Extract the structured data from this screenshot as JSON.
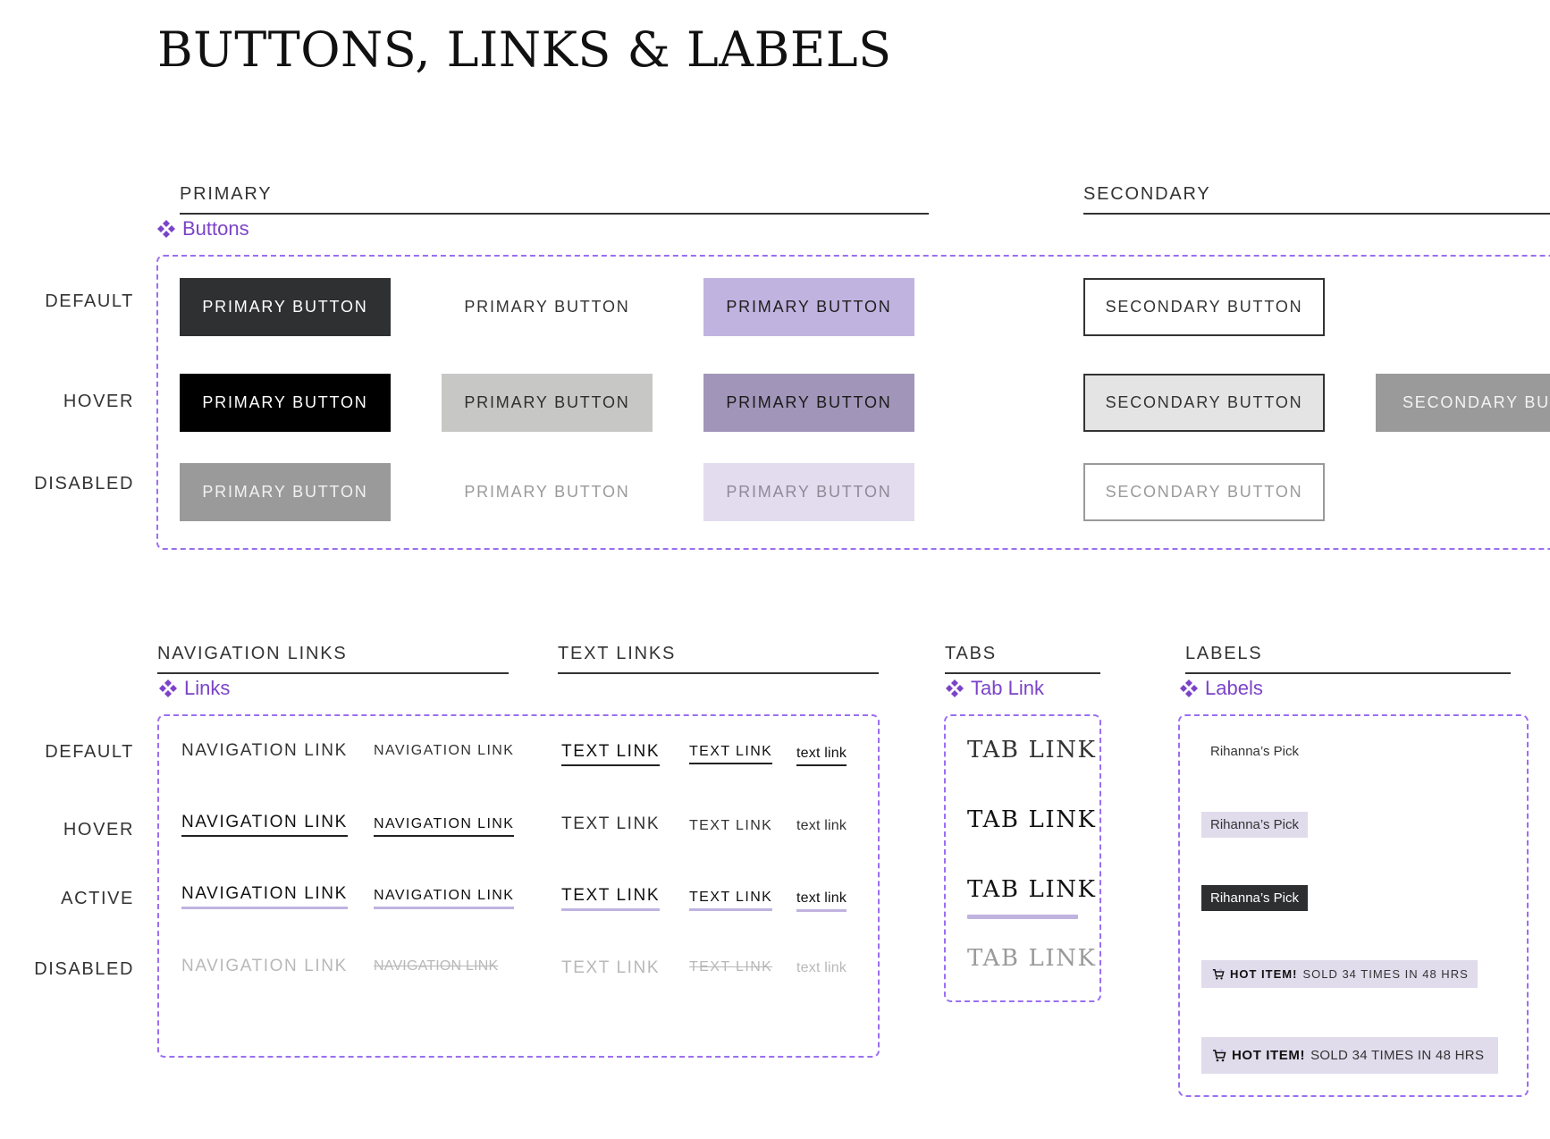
{
  "page_title": "BUTTONS, LINKS & LABELS",
  "colors": {
    "accent": "#7b43c8",
    "frame": "#9b6ff0",
    "lavender": "#c0b3e0"
  },
  "sections": {
    "primary": "PRIMARY",
    "secondary": "SECONDARY",
    "navigation_links": "NAVIGATION LINKS",
    "text_links": "TEXT LINKS",
    "tabs": "TABS",
    "labels": "LABELS"
  },
  "component_tags": {
    "buttons": "Buttons",
    "links": "Links",
    "tab_link": "Tab Link",
    "labels": "Labels"
  },
  "button_rows": {
    "default": "DEFAULT",
    "hover": "HOVER",
    "disabled": "DISABLED"
  },
  "link_rows": {
    "default": "DEFAULT",
    "hover": "HOVER",
    "active": "ACTIVE",
    "disabled": "DISABLED"
  },
  "buttons": {
    "primary_label": "PRIMARY BUTTON",
    "secondary_label": "SECONDARY BUTTON",
    "secondary_truncated": "SECONDARY BUT"
  },
  "links": {
    "navigation": "NAVIGATION LINK",
    "text_upper": "TEXT LINK",
    "text_lower": "text link"
  },
  "tabs": {
    "label": "TAB LINK"
  },
  "labels": {
    "pick": "Rihanna’s Pick",
    "hot_strong": "HOT ITEM!",
    "hot_rest": "SOLD 34 TIMES IN 48 HRS",
    "icon": "cart-icon"
  }
}
